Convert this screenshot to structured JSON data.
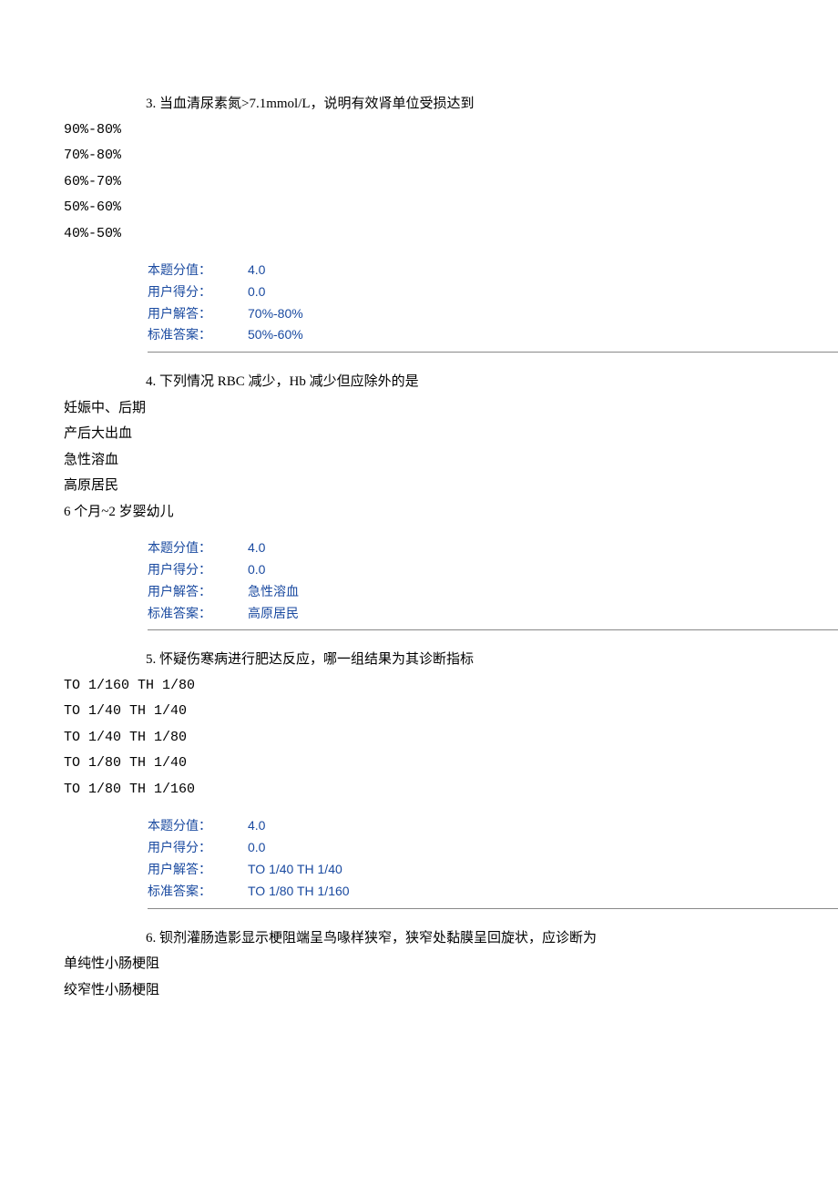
{
  "questions": [
    {
      "num": "3.",
      "text": "当血清尿素氮>7.1mmol/L，说明有效肾单位受损达到",
      "options": [
        "90%-80%",
        "70%-80%",
        "60%-70%",
        "50%-60%",
        "40%-50%"
      ],
      "meta": {
        "score_label": "本题分值：",
        "score_value": "4.0",
        "user_score_label": "用户得分：",
        "user_score_value": "0.0",
        "user_answer_label": "用户解答：",
        "user_answer_value": "70%-80%",
        "correct_label": "标准答案：",
        "correct_value": "50%-60%"
      }
    },
    {
      "num": "4.",
      "text": "下列情况 RBC 减少，Hb 减少但应除外的是",
      "options": [
        "妊娠中、后期",
        "产后大出血",
        "急性溶血",
        "高原居民",
        "6 个月~2 岁婴幼儿"
      ],
      "meta": {
        "score_label": "本题分值：",
        "score_value": "4.0",
        "user_score_label": "用户得分：",
        "user_score_value": "0.0",
        "user_answer_label": "用户解答：",
        "user_answer_value": "急性溶血",
        "correct_label": "标准答案：",
        "correct_value": "高原居民"
      }
    },
    {
      "num": "5.",
      "text": "怀疑伤寒病进行肥达反应，哪一组结果为其诊断指标",
      "options": [
        "TO 1/160 TH 1/80",
        "TO 1/40 TH 1/40",
        "TO 1/40 TH 1/80",
        "TO 1/80 TH 1/40",
        "TO 1/80 TH 1/160"
      ],
      "meta": {
        "score_label": "本题分值：",
        "score_value": "4.0",
        "user_score_label": "用户得分：",
        "user_score_value": "0.0",
        "user_answer_label": "用户解答：",
        "user_answer_value": "TO 1/40 TH 1/40",
        "correct_label": "标准答案：",
        "correct_value": "TO 1/80 TH 1/160"
      }
    },
    {
      "num": "6.",
      "text": "钡剂灌肠造影显示梗阻端呈鸟喙样狭窄，狭窄处黏膜呈回旋状，应诊断为",
      "options": [
        "单纯性小肠梗阻",
        "绞窄性小肠梗阻"
      ],
      "meta": null
    }
  ]
}
